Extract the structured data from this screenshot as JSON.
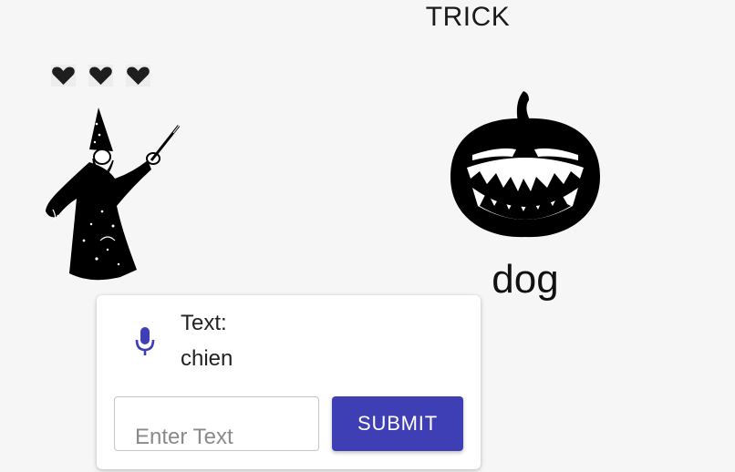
{
  "header": {
    "title": "TRICK"
  },
  "lives": {
    "hearts": [
      "heart-icon",
      "heart-icon",
      "heart-icon"
    ],
    "count": 3,
    "color": "#1e1e1e"
  },
  "character": {
    "icon": "wizard-icon"
  },
  "prompt": {
    "icon": "pumpkin-icon",
    "word": "dog"
  },
  "answer_card": {
    "mic_icon": "microphone-icon",
    "mic_color": "#3f3fb5",
    "label": "Text:",
    "recognized_text": "chien",
    "input_placeholder": "Enter Text",
    "input_value": "",
    "submit_label": "SUBMIT",
    "submit_color": "#3f3fb5"
  }
}
